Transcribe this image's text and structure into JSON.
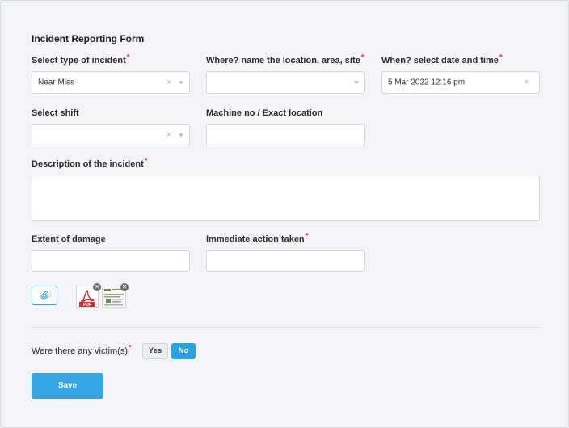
{
  "form": {
    "title": "Incident Reporting Form",
    "fields": {
      "incident_type": {
        "label": "Select type of incident",
        "required_mark": "*",
        "value": "Near Miss"
      },
      "location": {
        "label": "Where? name the location, area, site",
        "required_mark": "*",
        "value": ""
      },
      "datetime": {
        "label": "When? select date and time",
        "required_mark": "*",
        "value": "5 Mar 2022 12:16 pm"
      },
      "shift": {
        "label": "Select shift",
        "value": ""
      },
      "machine": {
        "label": "Machine no / Exact location",
        "value": ""
      },
      "description": {
        "label": "Description of the incident",
        "required_mark": "*",
        "value": ""
      },
      "damage": {
        "label": "Extent of damage",
        "value": ""
      },
      "action": {
        "label": "Immediate action taken",
        "required_mark": "*",
        "value": ""
      }
    },
    "attachments": [
      {
        "type": "pdf",
        "icon": "pdf-file-icon",
        "badge": "PDF"
      },
      {
        "type": "image",
        "icon": "document-image-icon"
      }
    ],
    "victims": {
      "question": "Were there any victim(s)",
      "required_mark": "*",
      "options": {
        "yes": "Yes",
        "no": "No"
      },
      "selected": "No"
    },
    "save_label": "Save"
  },
  "colors": {
    "accent": "#2aa3e1",
    "required": "#e53935",
    "pdf_red": "#d32f2f"
  }
}
